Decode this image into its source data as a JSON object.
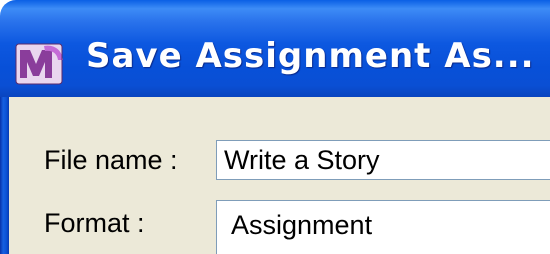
{
  "window": {
    "title": "Save Assignment As...",
    "icon": "app-logo-icon"
  },
  "form": {
    "file_name_label": "File name :",
    "file_name_value": "Write a Story",
    "format_label": "Format :",
    "format_value": "Assignment"
  },
  "colors": {
    "titlebar": "#0a50d8",
    "client_background": "#ece9d8",
    "field_border": "#7f9db9",
    "icon_purple": "#8a3d9b"
  }
}
